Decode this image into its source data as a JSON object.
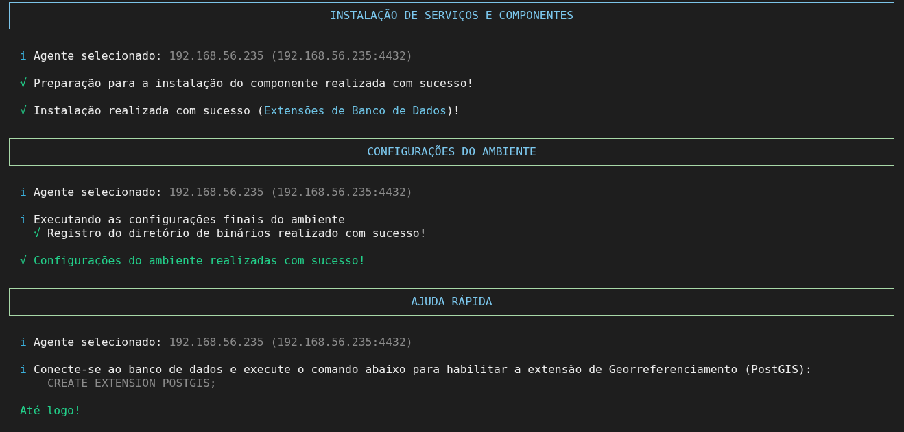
{
  "blocks": [
    {
      "kind": "banner",
      "title": "INSTALAÇÃO DE SERVIÇOS E COMPONENTES",
      "color": "#7cc4e8"
    },
    {
      "kind": "message",
      "lines": [
        {
          "marker": "i",
          "kind": "info",
          "segments": [
            {
              "text": "Agente selecionado: ",
              "kind": "plain"
            },
            {
              "text": "192.168.56.235 (192.168.56.235:4432)",
              "kind": "muted"
            }
          ]
        }
      ]
    },
    {
      "kind": "message",
      "lines": [
        {
          "marker": "√",
          "kind": "success",
          "segments": [
            {
              "text": "Preparação para a instalação do componente realizada com sucesso!",
              "kind": "plain"
            }
          ]
        }
      ]
    },
    {
      "kind": "message",
      "lines": [
        {
          "marker": "√",
          "kind": "success",
          "segments": [
            {
              "text": "Instalação realizada com sucesso (",
              "kind": "plain"
            },
            {
              "text": "Extensões de Banco de Dados",
              "kind": "accent"
            },
            {
              "text": ")!",
              "kind": "plain"
            }
          ]
        }
      ]
    },
    {
      "kind": "banner",
      "title": "CONFIGURAÇÕES DO AMBIENTE",
      "color": "#a8d8a8"
    },
    {
      "kind": "message",
      "lines": [
        {
          "marker": "i",
          "kind": "info",
          "segments": [
            {
              "text": "Agente selecionado: ",
              "kind": "plain"
            },
            {
              "text": "192.168.56.235 (192.168.56.235:4432)",
              "kind": "muted"
            }
          ]
        }
      ]
    },
    {
      "kind": "message",
      "lines": [
        {
          "marker": "i",
          "kind": "info",
          "segments": [
            {
              "text": "Executando as configurações finais do ambiente",
              "kind": "plain"
            }
          ],
          "children": [
            {
              "marker": "√",
              "kind": "success",
              "segments": [
                {
                  "text": "Registro do diretório de binários realizado com sucesso!",
                  "kind": "plain"
                }
              ]
            }
          ]
        }
      ]
    },
    {
      "kind": "message",
      "lines": [
        {
          "marker": "√",
          "kind": "success",
          "segments": [
            {
              "text": "Configurações do ambiente realizadas com sucesso!",
              "kind": "success"
            }
          ]
        }
      ]
    },
    {
      "kind": "banner",
      "title": "AJUDA RÁPIDA",
      "color": "#a8d8a8"
    },
    {
      "kind": "message",
      "lines": [
        {
          "marker": "i",
          "kind": "info",
          "segments": [
            {
              "text": "Agente selecionado: ",
              "kind": "plain"
            },
            {
              "text": "192.168.56.235 (192.168.56.235:4432)",
              "kind": "muted"
            }
          ]
        }
      ]
    },
    {
      "kind": "message",
      "lines": [
        {
          "marker": "i",
          "kind": "info",
          "segments": [
            {
              "text": "Conecte-se ao banco de dados e execute o comando abaixo para habilitar a extensão de Georreferenciamento (PostGIS):",
              "kind": "plain"
            }
          ],
          "children": [
            {
              "segments": [
                {
                  "text": "CREATE EXTENSION POSTGIS;",
                  "kind": "muted"
                }
              ]
            }
          ]
        }
      ]
    },
    {
      "kind": "message",
      "lines": [
        {
          "segments": [
            {
              "text": "Até logo!",
              "kind": "success"
            }
          ]
        }
      ]
    }
  ]
}
